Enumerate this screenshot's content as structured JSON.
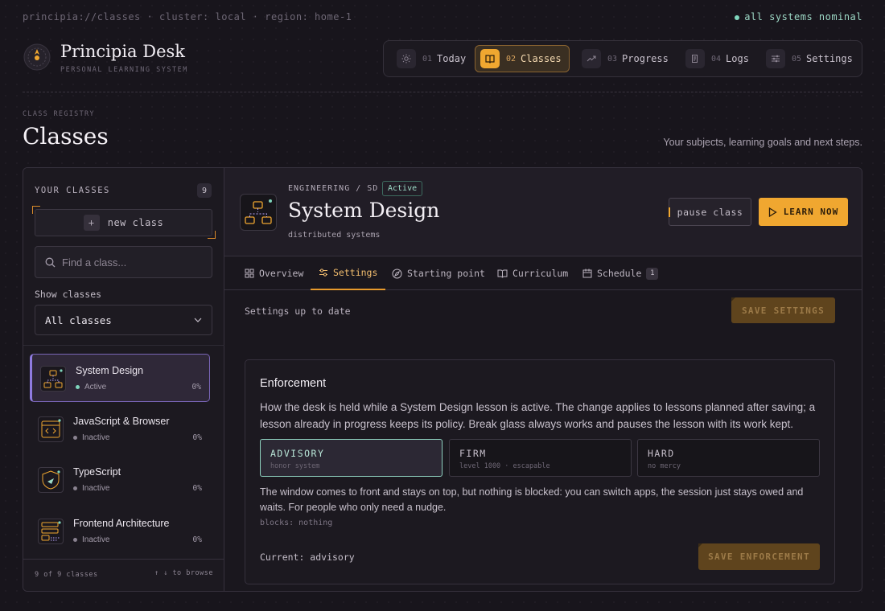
{
  "topbar": {
    "path": "principia://classes · cluster: local · region: home-1",
    "status": "all systems nominal"
  },
  "brand": {
    "name": "Principia Desk",
    "subtitle": "PERSONAL LEARNING SYSTEM"
  },
  "nav": [
    {
      "num": "01",
      "label": "Today",
      "icon": "sun-icon"
    },
    {
      "num": "02",
      "label": "Classes",
      "icon": "book-icon"
    },
    {
      "num": "03",
      "label": "Progress",
      "icon": "trend-icon"
    },
    {
      "num": "04",
      "label": "Logs",
      "icon": "scroll-icon"
    },
    {
      "num": "05",
      "label": "Settings",
      "icon": "sliders-icon"
    }
  ],
  "page": {
    "eyebrow": "CLASS REGISTRY",
    "title": "Classes",
    "tagline": "Your subjects, learning goals and next steps."
  },
  "sidebar": {
    "title": "YOUR CLASSES",
    "count": "9",
    "new_class": "new class",
    "search_placeholder": "Find a class...",
    "show_label": "Show classes",
    "filter_value": "All classes",
    "classes": [
      {
        "name": "System Design",
        "status": "Active",
        "pct": "0%",
        "icon": "diagram-icon"
      },
      {
        "name": "JavaScript & Browser",
        "status": "Inactive",
        "pct": "0%",
        "icon": "browser-code-icon"
      },
      {
        "name": "TypeScript",
        "status": "Inactive",
        "pct": "0%",
        "icon": "shield-icon"
      },
      {
        "name": "Frontend Architecture",
        "status": "Inactive",
        "pct": "0%",
        "icon": "layout-icon"
      }
    ],
    "footer_count": "9 of 9 classes",
    "footer_hint": "↑ ↓ to browse"
  },
  "main": {
    "crumb": "ENGINEERING / SD",
    "badge": "Active",
    "title": "System Design",
    "subtitle": "distributed systems",
    "pause_label": "pause class",
    "learn_label": "LEARN NOW",
    "tabs": [
      {
        "label": "Overview"
      },
      {
        "label": "Settings"
      },
      {
        "label": "Starting point"
      },
      {
        "label": "Curriculum"
      },
      {
        "label": "Schedule",
        "count": "1"
      }
    ],
    "save_status": "Settings up to date",
    "save_settings": "SAVE SETTINGS",
    "enforcement": {
      "title": "Enforcement",
      "text": "How the desk is held while a System Design lesson is active. The change applies to lessons planned after saving; a lesson already in progress keeps its policy. Break glass always works and pauses the lesson with its work kept.",
      "options": [
        {
          "title": "ADVISORY",
          "sub": "honor system"
        },
        {
          "title": "FIRM",
          "sub": "level 1000 · escapable"
        },
        {
          "title": "HARD",
          "sub": "no mercy"
        }
      ],
      "description": "The window comes to front and stays on top, but nothing is blocked: you can switch apps, the session just stays owed and waits. For people who only need a nudge.",
      "blocks": "blocks: nothing",
      "current": "Current: advisory",
      "save": "SAVE ENFORCEMENT"
    }
  },
  "colors": {
    "accent": "#f0a730",
    "mint": "#7fd6bd",
    "selection": "#8f7be0"
  }
}
